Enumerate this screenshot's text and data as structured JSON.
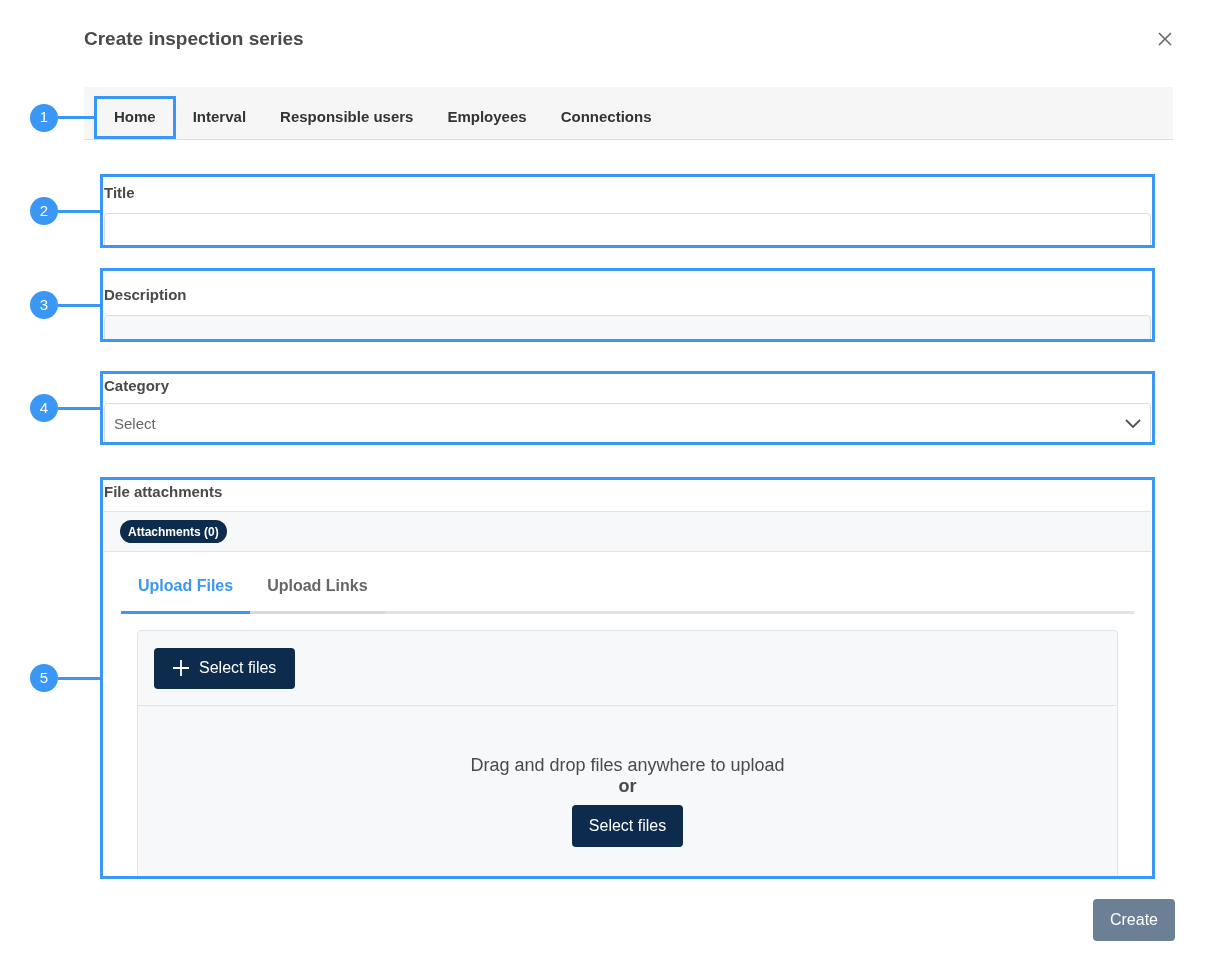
{
  "dialog": {
    "title": "Create inspection series"
  },
  "tabs": [
    {
      "label": "Home",
      "callout": "1"
    },
    {
      "label": "Interval"
    },
    {
      "label": "Responsible users"
    },
    {
      "label": "Employees"
    },
    {
      "label": "Connections"
    }
  ],
  "fields": [
    {
      "kind": "text",
      "callout": "2",
      "label": "Title"
    },
    {
      "kind": "textarea",
      "callout": "3",
      "label": "Description"
    },
    {
      "kind": "select",
      "callout": "4",
      "label": "Category",
      "placeholder": "Select"
    }
  ],
  "attachments": {
    "callout": "5",
    "label": "File attachments",
    "badge": "Attachments (0)",
    "tabs": [
      {
        "label": "Upload Files",
        "selected": true
      },
      {
        "label": "Upload Links",
        "selected": false
      }
    ],
    "select_button": "Select files",
    "drop_text": "Drag and drop files anywhere to upload",
    "or": "or",
    "drop_button": "Select files"
  },
  "create_button": {
    "label": "Create",
    "disabled": true
  }
}
